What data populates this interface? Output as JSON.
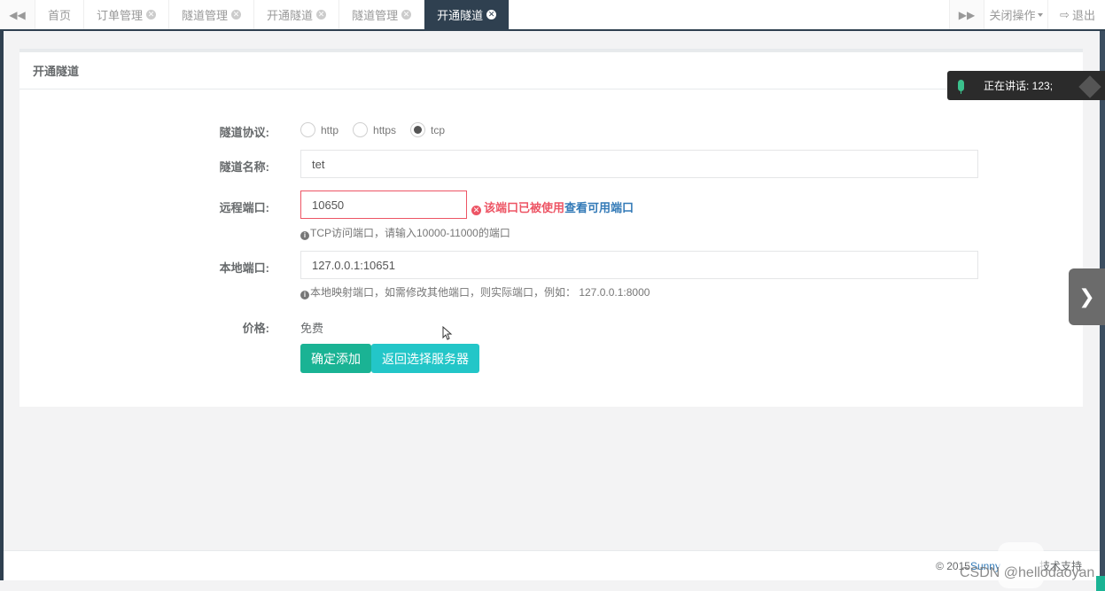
{
  "tabbar": {
    "prev_icon": "double-left-arrow",
    "next_icon": "double-right-arrow",
    "tabs": [
      {
        "label": "首页",
        "closable": false,
        "active": false
      },
      {
        "label": "订单管理",
        "closable": true,
        "active": false
      },
      {
        "label": "隧道管理",
        "closable": true,
        "active": false
      },
      {
        "label": "开通隧道",
        "closable": true,
        "active": false
      },
      {
        "label": "隧道管理",
        "closable": true,
        "active": false
      },
      {
        "label": "开通隧道",
        "closable": true,
        "active": true
      }
    ],
    "close_ops_label": "关闭操作",
    "logout_label": "退出"
  },
  "panel": {
    "title": "开通隧道"
  },
  "form": {
    "protocol": {
      "label": "隧道协议:",
      "options": [
        "http",
        "https",
        "tcp"
      ],
      "selected": "tcp"
    },
    "name": {
      "label": "隧道名称:",
      "value": "tet"
    },
    "remote_port": {
      "label": "远程端口:",
      "value": "10650",
      "error": "该端口已被使用",
      "error_link": "查看可用端口",
      "help": "TCP访问端口，请输入10000-11000的端口"
    },
    "local_port": {
      "label": "本地端口:",
      "value": "127.0.0.1:10651",
      "help": "本地映射端口，如需修改其他端口，则实际端口，例如： 127.0.0.1:8000"
    },
    "price": {
      "label": "价格:",
      "value": "免费"
    },
    "submit_label": "确定添加",
    "back_label": "返回选择服务器"
  },
  "footer": {
    "prefix": "© 2015 ",
    "brand": "Sunny",
    "suffix": "技术支持"
  },
  "overlay": {
    "speaking": "正在讲话: 123;",
    "watermark": "CSDN @hellodaoyan"
  },
  "colors": {
    "nav_dark": "#2f4050",
    "primary": "#1ab394",
    "info": "#23c6c8",
    "danger": "#ed5565",
    "link": "#337ab7"
  }
}
